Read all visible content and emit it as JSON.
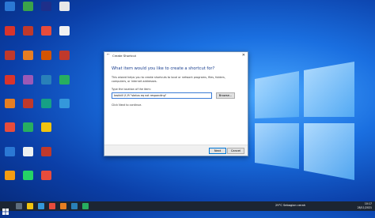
{
  "dialog": {
    "title": "Create Shortcut",
    "close_glyph": "✕",
    "back_glyph": "←",
    "heading": "What item would you like to create a shortcut for?",
    "description": "This wizard helps you to create shortcuts to local or network programs, files, folders, computers, or Internet addresses.",
    "location_label": "Type the location of the item:",
    "location_value": "taskkill /f /fi \"status eq not responding\"",
    "browse_label": "Browse...",
    "hint": "Click Next to continue.",
    "next_label": "Next",
    "cancel_label": "Cancel"
  },
  "desktop_icons": [
    {
      "label": "",
      "color": "#2b78d4"
    },
    {
      "label": "",
      "color": "#3aa34a"
    },
    {
      "label": "",
      "color": "#1e2f8a"
    },
    {
      "label": "",
      "color": "#d9342b"
    },
    {
      "label": "",
      "color": "#c0392b"
    },
    {
      "label": "",
      "color": "#9b59b6"
    },
    {
      "label": "",
      "color": "#e67e22"
    },
    {
      "label": "",
      "color": "#27ae60"
    }
  ],
  "taskbar": {
    "weather": "29°C  Sebagian cerah",
    "time": "10:17",
    "date": "28/11/2021"
  },
  "colors": {
    "accent": "#0078d7",
    "taskbar": "#1c2532"
  }
}
